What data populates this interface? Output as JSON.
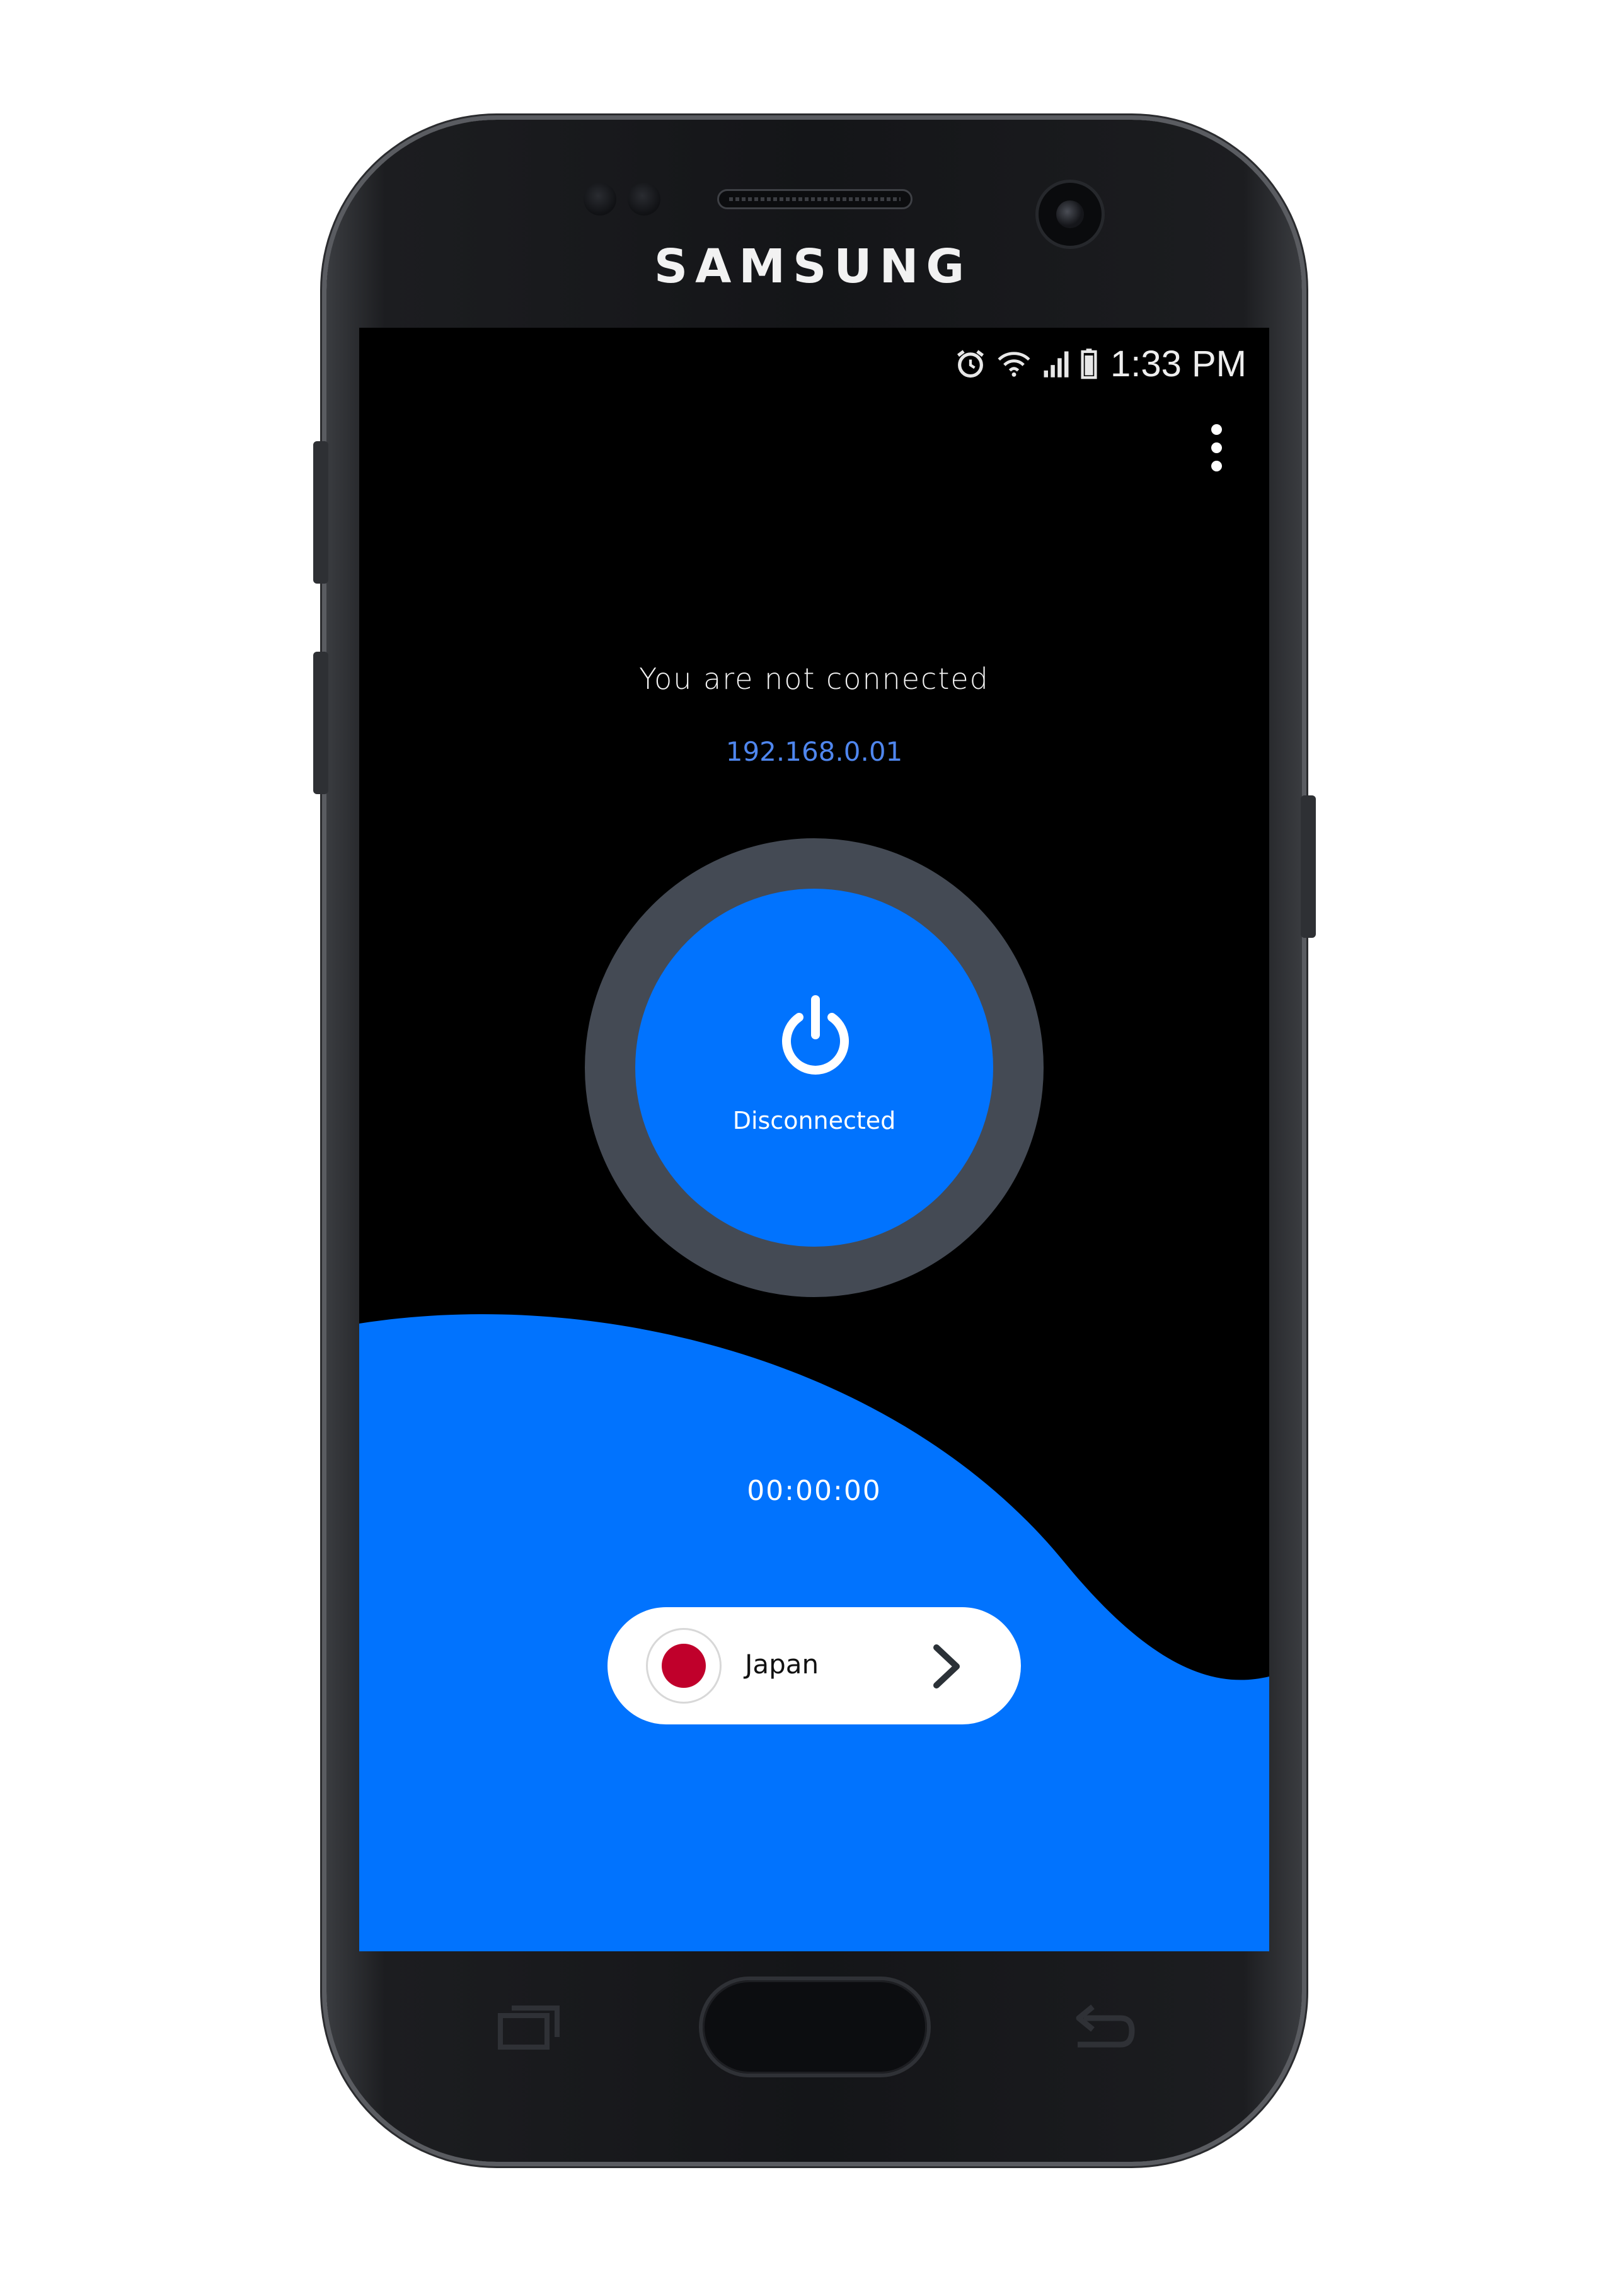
{
  "device": {
    "brand": "SAMSUNG"
  },
  "status_bar": {
    "time": "1:33 PM",
    "icons": [
      "alarm-icon",
      "wifi-icon",
      "signal-icon",
      "battery-icon"
    ]
  },
  "header": {
    "menu_icon": "more-vertical-icon"
  },
  "connection": {
    "status_text": "You are not connected",
    "ip_address": "192.168.0.01",
    "button_label": "Disconnected",
    "button_icon": "power-icon",
    "timer": "00:00:00"
  },
  "server": {
    "country": "Japan",
    "flag_icon": "japan-flag-icon",
    "arrow_icon": "chevron-right-icon"
  },
  "nav_keys": [
    "recent-apps-icon",
    "home-button",
    "back-icon"
  ],
  "colors": {
    "accent": "#0173fe",
    "ring": "#444a54",
    "ip_text": "#4f86ee",
    "background": "#000000",
    "flag_red": "#c0002b"
  }
}
